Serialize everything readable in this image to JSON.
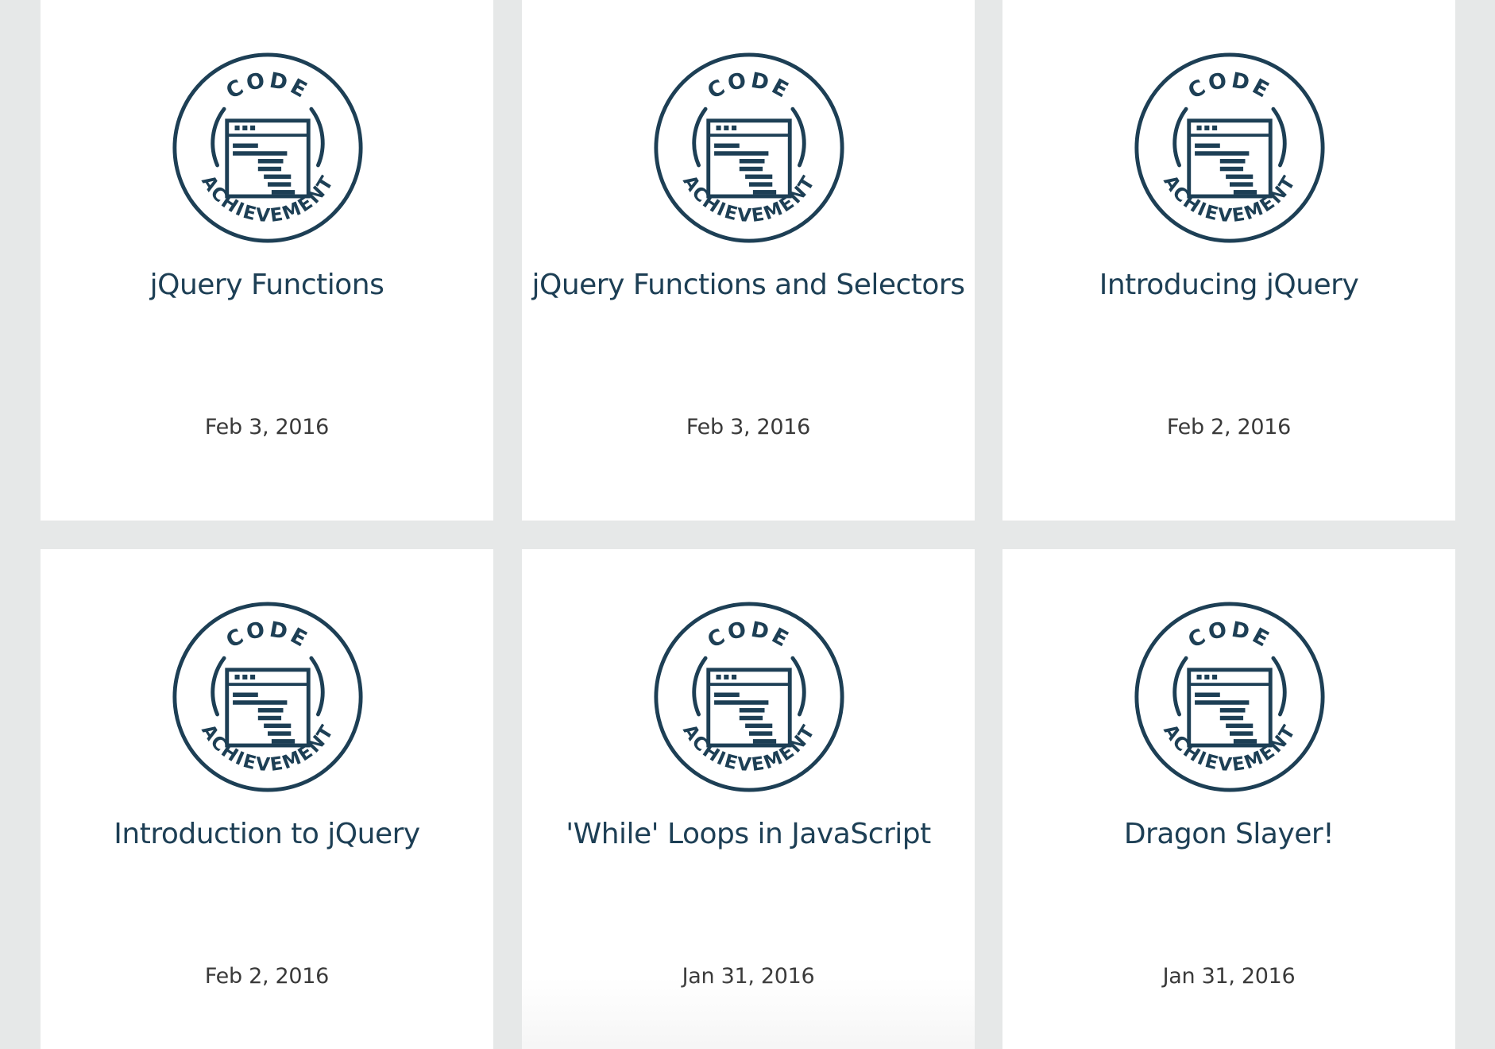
{
  "badge": {
    "top_text": "CODE",
    "bottom_text": "ACHIEVEMENT",
    "color": "#1d3f55"
  },
  "achievements": [
    {
      "title": "jQuery Functions",
      "date": "Feb 3, 2016"
    },
    {
      "title": "jQuery Functions and Selectors",
      "date": "Feb 3, 2016"
    },
    {
      "title": "Introducing jQuery",
      "date": "Feb 2, 2016"
    },
    {
      "title": "Introduction to jQuery",
      "date": "Feb 2, 2016"
    },
    {
      "title": "'While' Loops in JavaScript",
      "date": "Jan 31, 2016"
    },
    {
      "title": "Dragon Slayer!",
      "date": "Jan 31, 2016"
    }
  ],
  "colors": {
    "page_background": "#e6e8e8",
    "card_background": "#ffffff",
    "title_text": "#1d3f55",
    "date_text": "#3a3a3a"
  }
}
